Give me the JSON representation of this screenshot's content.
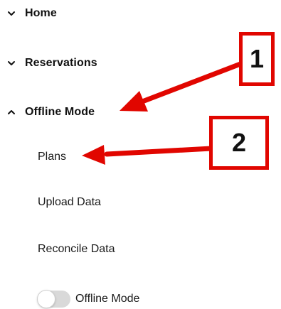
{
  "nav": {
    "sections": [
      {
        "label": "Home",
        "expanded": false
      },
      {
        "label": "Reservations",
        "expanded": false
      },
      {
        "label": "Offline Mode",
        "expanded": true
      }
    ],
    "sub_items": [
      {
        "label": "Plans"
      },
      {
        "label": "Upload Data"
      },
      {
        "label": "Reconcile Data"
      }
    ],
    "toggle": {
      "label": "Offline Mode",
      "on": false
    }
  },
  "annotations": {
    "color": "#e10600",
    "callouts": [
      {
        "number": "1",
        "target": "Offline Mode"
      },
      {
        "number": "2",
        "target": "Plans"
      }
    ]
  },
  "icons": {
    "collapsed": "chevron-down-icon",
    "expanded": "chevron-up-icon"
  }
}
